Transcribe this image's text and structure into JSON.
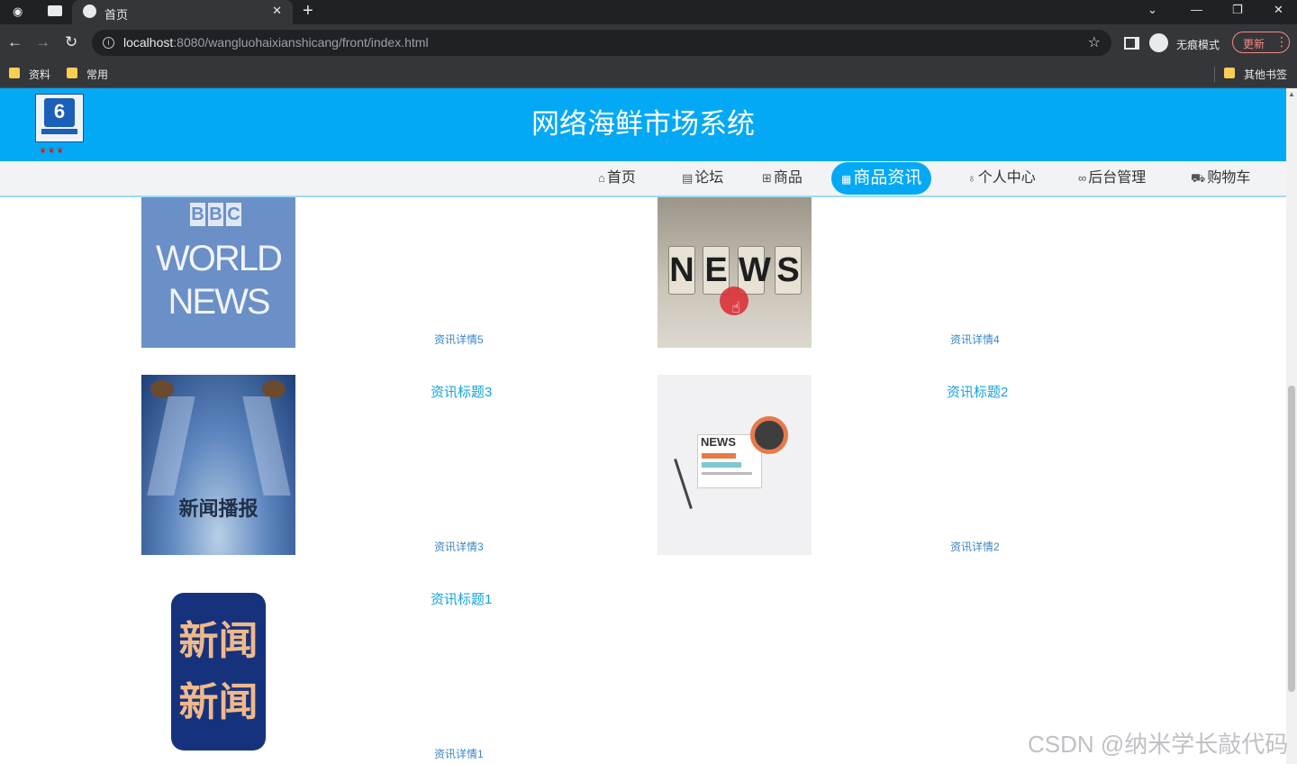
{
  "browser": {
    "tab_title": "首页",
    "url_host": "localhost",
    "url_path": ":8080/wangluohaixianshicang/front/index.html",
    "incognito_label": "无痕模式",
    "update_label": "更新",
    "bookmarks": [
      "资料",
      "常用",
      "其他书签"
    ]
  },
  "site": {
    "title": "网络海鲜市场系统",
    "nav": [
      {
        "label": "首页",
        "icon": "home-icon"
      },
      {
        "label": "论坛",
        "icon": "forum-icon"
      },
      {
        "label": "商品",
        "icon": "gift-icon"
      },
      {
        "label": "商品资讯",
        "icon": "news-icon",
        "active": true
      },
      {
        "label": "个人中心",
        "icon": "user-icon"
      },
      {
        "label": "后台管理",
        "icon": "link-icon"
      },
      {
        "label": "购物车",
        "icon": "cart-icon"
      }
    ]
  },
  "news": [
    {
      "title": "",
      "detail": "资讯详情5",
      "image_text": [
        "B",
        "B",
        "C",
        "WORLD",
        "NEWS"
      ]
    },
    {
      "title": "",
      "detail": "资讯详情4",
      "image_text": [
        "N",
        "E",
        "W",
        "S"
      ]
    },
    {
      "title": "资讯标题3",
      "detail": "资讯详情3",
      "image_text": "新闻播报"
    },
    {
      "title": "资讯标题2",
      "detail": "资讯详情2",
      "image_text": "NEWS"
    },
    {
      "title": "资讯标题1",
      "detail": "资讯详情1",
      "image_text": [
        "新闻",
        "新闻"
      ]
    }
  ],
  "watermark": "CSDN @纳米学长敲代码",
  "colors": {
    "primary": "#03a9f4",
    "link": "#16a2dc"
  }
}
